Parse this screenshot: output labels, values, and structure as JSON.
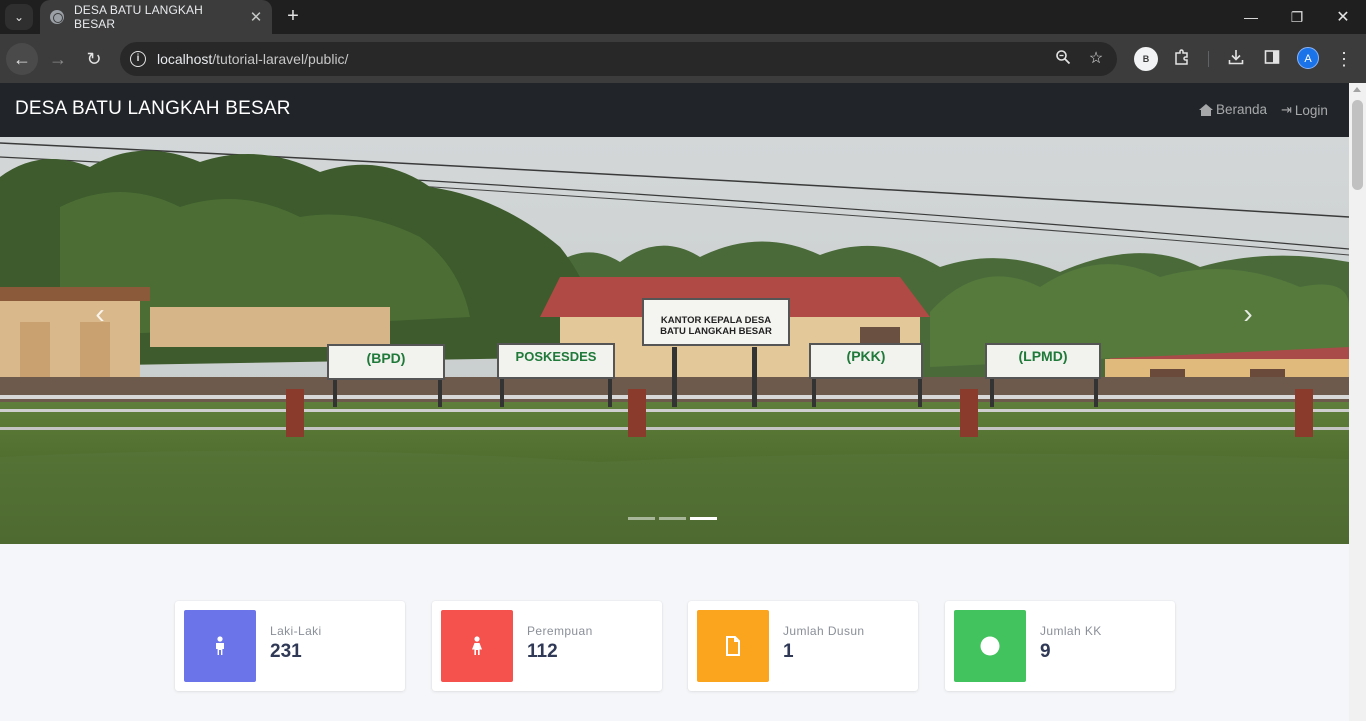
{
  "browser": {
    "tab_title": "DESA BATU LANGKAH BESAR",
    "url_host": "localhost",
    "url_path": "/tutorial-laravel/public/",
    "profile_initial": "B",
    "account_initial": "A",
    "icons": [
      "tab-list-icon",
      "tab-favicon",
      "tab-close-icon",
      "new-tab-icon",
      "back-icon",
      "forward-icon",
      "reload-icon",
      "site-info-icon",
      "zoom-icon",
      "bookmark-star-icon",
      "extensions-icon",
      "download-icon",
      "side-panel-icon",
      "menu-icon",
      "minimize-icon",
      "restore-icon",
      "window-close-icon"
    ]
  },
  "navbar": {
    "brand": "DESA BATU LANGKAH BESAR",
    "links": [
      {
        "label": "Beranda",
        "icon": "home-icon"
      },
      {
        "label": "Login",
        "icon": "login-icon"
      }
    ]
  },
  "carousel": {
    "signs": {
      "main_title": "KANTOR KEPALA DESA",
      "main_subtitle": "BATU LANGKAH BESAR",
      "bpd": "(BPD)",
      "poskesdes": "POSKESDES",
      "pkk": "(PKK)",
      "lpmd": "(LPMD)"
    },
    "slide_count": 3,
    "active_slide": 3
  },
  "stats": [
    {
      "label": "Laki-Laki",
      "value": "231",
      "color": "#6c74ea",
      "icon": "male-icon"
    },
    {
      "label": "Perempuan",
      "value": "112",
      "color": "#f5524e",
      "icon": "female-icon"
    },
    {
      "label": "Jumlah Dusun",
      "value": "1",
      "color": "#fba51f",
      "icon": "file-icon"
    },
    {
      "label": "Jumlah KK",
      "value": "9",
      "color": "#43c35e",
      "icon": "circle-icon"
    }
  ]
}
